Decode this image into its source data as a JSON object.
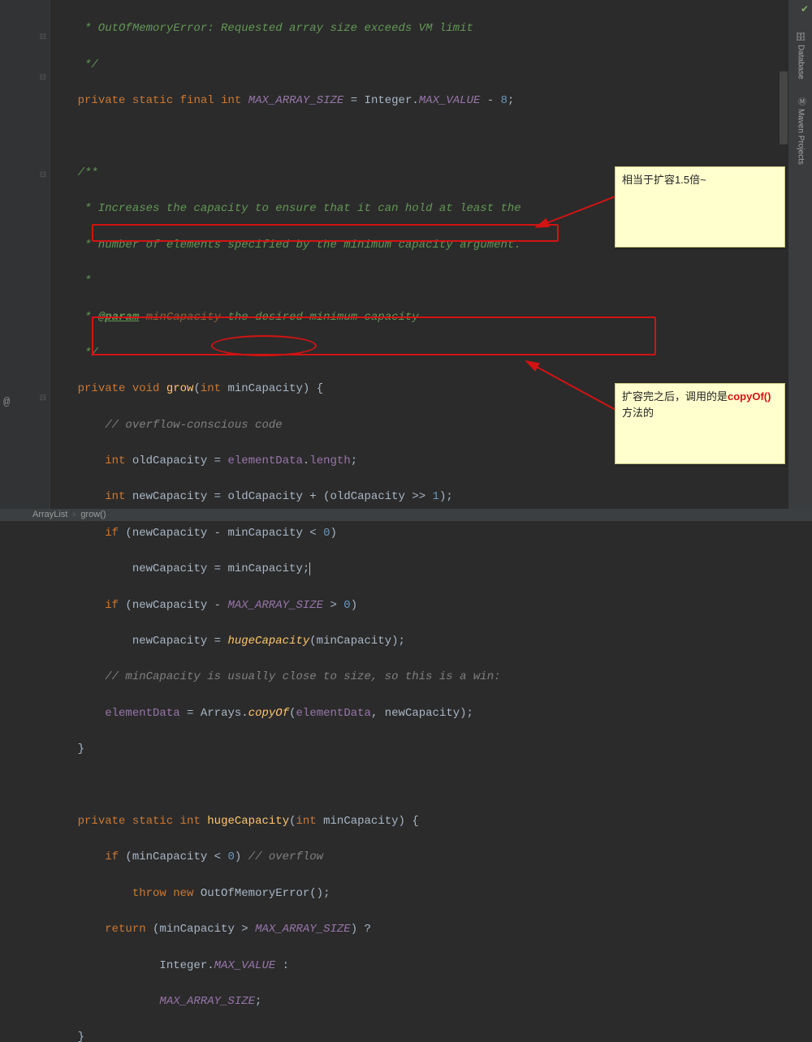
{
  "breadcrumb": {
    "class": "ArrayList",
    "method": "grow()"
  },
  "sidebar": {
    "database": "Database",
    "maven": "Maven Projects"
  },
  "notes": {
    "n1": "相当于扩容1.5倍~",
    "n2a": "扩容完之后，调用的是",
    "n2b": "copyOf()",
    "n2c": "方法的"
  },
  "code": {
    "l00a": "     * OutOfMemoryError: Requested array size exceeds VM limit",
    "l01a": "     */",
    "l02_indent": "    ",
    "l02_private": "private",
    "l02_static": "static",
    "l02_final": "final",
    "l02_int": "int",
    "l02_name": "MAX_ARRAY_SIZE",
    "l02_eq": " = ",
    "l02_cls": "Integer",
    "l02_dot": ".",
    "l02_mv": "MAX_VALUE",
    "l02_minus": " - ",
    "l02_8": "8",
    "l02_semi": ";",
    "l04a": "    /**",
    "l05a": "     * Increases the capacity to ensure that it can hold at least the",
    "l06a": "     * number of elements specified by the minimum capacity argument.",
    "l07a": "     *",
    "l08_pre": "     * ",
    "l08_tag": "@param",
    "l08_p": " minCapacity",
    "l08_rest": " the desired minimum capacity",
    "l09a": "     */",
    "l10_indent": "    ",
    "l10_private": "private",
    "l10_void": "void",
    "l10_name": "grow",
    "l10_paren": "(",
    "l10_int": "int",
    "l10_param": " minCapacity) {",
    "l11a": "        // overflow-conscious code",
    "l12_indent": "        ",
    "l12_int": "int",
    "l12_sp": " ",
    "l12_old": "oldCapacity",
    "l12_eq": " = ",
    "l12_ed": "elementData",
    "l12_dot": ".",
    "l12_len": "length",
    "l12_semi": ";",
    "l13_indent": "        ",
    "l13_int": "int",
    "l13_sp": " ",
    "l13_new": "newCapacity",
    "l13_eq": " = ",
    "l13_old": "oldCapacity",
    "l13_plus": " + (",
    "l13_old2": "oldCapacity",
    "l13_shr": " >> ",
    "l13_1": "1",
    "l13_close": ");",
    "l14_indent": "        ",
    "l14_if": "if",
    "l14_rest": " (newCapacity - minCapacity < ",
    "l14_0": "0",
    "l14_close": ")",
    "l15_indent": "            ",
    "l15_new": "newCapacity = minCapacity;",
    "l16_indent": "        ",
    "l16_if": "if",
    "l16_open": " (newCapacity - ",
    "l16_mas": "MAX_ARRAY_SIZE",
    "l16_gt": " > ",
    "l16_0": "0",
    "l16_close": ")",
    "l17_indent": "            ",
    "l17_new": "newCapacity = ",
    "l17_huge": "hugeCapacity",
    "l17_rest": "(minCapacity);",
    "l18a": "        // minCapacity is usually close to size, so this is a win:",
    "l19_indent": "        ",
    "l19_ed": "elementData",
    "l19_eq": " = ",
    "l19_arr": "Arrays",
    "l19_dot": ".",
    "l19_copy": "copyOf",
    "l19_open": "(",
    "l19_ed2": "elementData",
    "l19_comma": ", newCapacity);",
    "l20a": "    }",
    "l22_indent": "    ",
    "l22_private": "private",
    "l22_static": "static",
    "l22_int": "int",
    "l22_name": " hugeCapacity",
    "l22_paren": "(",
    "l22_int2": "int",
    "l22_param": " minCapacity) {",
    "l23_indent": "        ",
    "l23_if": "if",
    "l23_open": " (minCapacity < ",
    "l23_0": "0",
    "l23_close": ") ",
    "l23_cmt": "// overflow",
    "l24_indent": "            ",
    "l24_throw": "throw new",
    "l24_cls": " OutOfMemoryError",
    "l24_rest": "();",
    "l25_indent": "        ",
    "l25_return": "return",
    "l25_open": " (minCapacity > ",
    "l25_mas": "MAX_ARRAY_SIZE",
    "l25_close": ") ?",
    "l26_indent": "                ",
    "l26_int": "Integer",
    "l26_dot": ".",
    "l26_mv": "MAX_VALUE",
    "l26_colon": " :",
    "l27_indent": "                ",
    "l27_mas": "MAX_ARRAY_SIZE",
    "l27_semi": ";",
    "l28a": "    }"
  }
}
